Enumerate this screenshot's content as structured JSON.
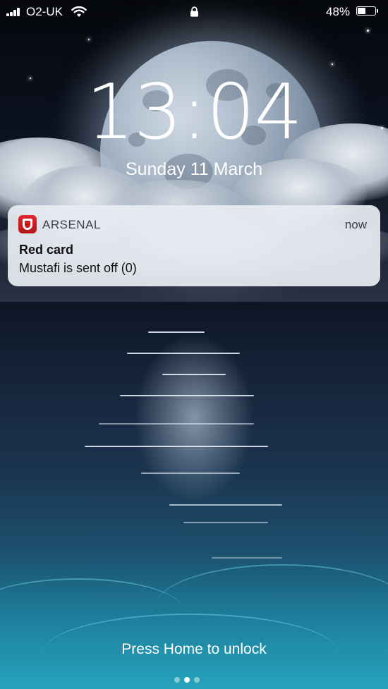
{
  "status_bar": {
    "carrier": "O2-UK",
    "battery_percent": "48%",
    "battery_level": 0.48,
    "icons": [
      "signal-icon",
      "wifi-icon",
      "lock-icon",
      "battery-icon"
    ]
  },
  "lock_screen": {
    "time": "13:04",
    "date": "Sunday 11 March"
  },
  "notification": {
    "app_name": "ARSENAL",
    "app_icon": "arsenal-app-icon",
    "time": "now",
    "title": "Red card",
    "body": "Mustafi is sent off (0)"
  },
  "footer": {
    "unlock_hint": "Press Home to unlock",
    "page_dots": 3,
    "active_page": 2
  },
  "colors": {
    "notification_bg": "#e8ecf2",
    "app_icon_red": "#d61f25",
    "sea_teal": "#27a4bd"
  }
}
